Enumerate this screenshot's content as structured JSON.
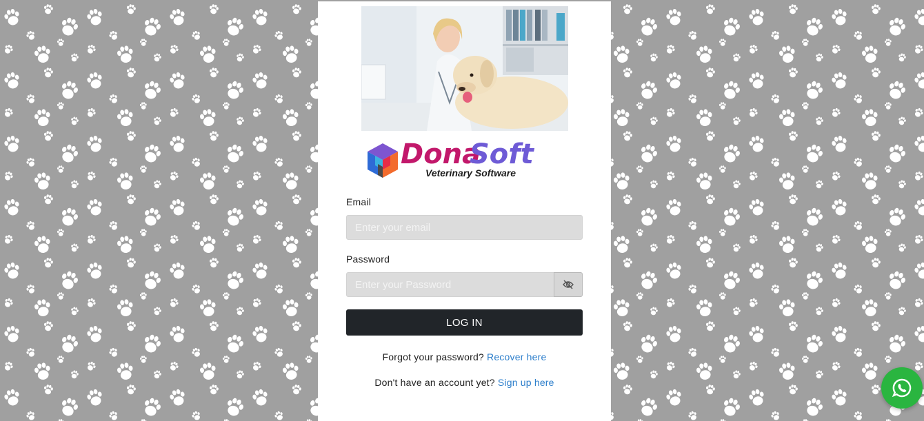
{
  "colors": {
    "background": "#a0a0a0",
    "card": "#ffffff",
    "accent_link": "#2c7ecb",
    "login_button": "#212529",
    "whatsapp": "#2ab540",
    "brand_pink": "#c2186b",
    "brand_violet": "#6e5bd6"
  },
  "brand": {
    "name_part1": "Dona",
    "name_part2": "Soft",
    "tagline": "Veterinary Software",
    "logo_icon": "cube-logo-icon"
  },
  "hero": {
    "icon": "vet-with-dog-photo"
  },
  "form": {
    "email_label": "Email",
    "email_placeholder": "Enter your email",
    "email_value": "",
    "password_label": "Password",
    "password_placeholder": "Enter your Password",
    "password_value": "",
    "toggle_icon": "eye-slash-icon",
    "login_label": "LOG IN"
  },
  "links": {
    "forgot_text": "Forgot your password?",
    "recover_link": "Recover here",
    "signup_text": "Don't have an account yet?",
    "signup_link": "Sign up here"
  },
  "whatsapp": {
    "icon": "whatsapp-icon"
  }
}
